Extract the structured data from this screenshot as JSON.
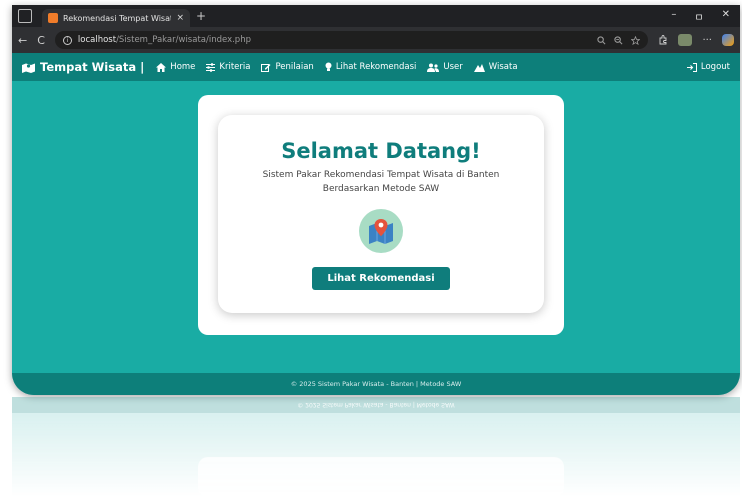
{
  "browser": {
    "tab_title": "Rekomendasi Tempat Wisata di B",
    "tab_close": "×",
    "new_tab": "+",
    "url_host": "localhost",
    "url_path": "/Sistem_Pakar/wisata/index.php",
    "nav_back": "←",
    "nav_reload": "C",
    "win_minimize": "–",
    "win_restore": "ㅁ",
    "win_close": "✕",
    "omni_icons": [
      "search-icon",
      "zoom-icon",
      "star-icon"
    ],
    "toolbar_icons": [
      "extensions-icon",
      "profile-icon",
      "more-icon",
      "copilot-icon"
    ]
  },
  "navbar": {
    "brand": "Tempat Wisata |",
    "items": [
      {
        "label": "Home",
        "icon": "home-icon"
      },
      {
        "label": "Kriteria",
        "icon": "sliders-icon"
      },
      {
        "label": "Penilaian",
        "icon": "edit-icon"
      },
      {
        "label": "Lihat Rekomendasi",
        "icon": "lightbulb-icon"
      },
      {
        "label": "User",
        "icon": "users-icon"
      },
      {
        "label": "Wisata",
        "icon": "mountain-icon"
      }
    ],
    "logout": "Logout"
  },
  "main": {
    "welcome": "Selamat Datang!",
    "subtitle": "Sistem Pakar Rekomendasi Tempat Wisata di Banten Berdasarkan Metode SAW",
    "cta": "Lihat Rekomendasi"
  },
  "footer": {
    "text": "© 2025 Sistem Pakar Wisata - Banten | Metode SAW"
  },
  "colors": {
    "teal_bg": "#19aca4",
    "teal_dark": "#0d7f7a",
    "title_color": "#0f7d7c"
  }
}
